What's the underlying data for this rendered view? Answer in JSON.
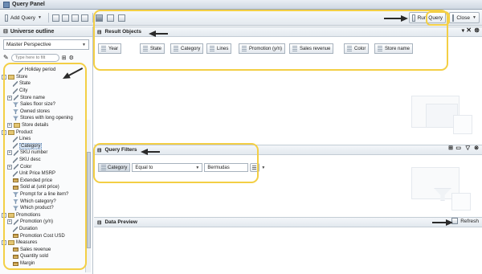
{
  "window": {
    "title": "Query Panel"
  },
  "toolbar": {
    "add_query_label": "Add Query",
    "run_query_label": "Run Query",
    "close_label": "Close"
  },
  "outline": {
    "title": "Universe outline",
    "perspective": "Master Perspective",
    "search_placeholder": "Type here to filt"
  },
  "tree": [
    {
      "label": "Holiday period",
      "indent": 3,
      "icon": "dimension",
      "expander": ""
    },
    {
      "label": "Store",
      "indent": 0,
      "icon": "folder",
      "expander": "-"
    },
    {
      "label": "State",
      "indent": 2,
      "icon": "dimension",
      "expander": ""
    },
    {
      "label": "City",
      "indent": 2,
      "icon": "dimension",
      "expander": ""
    },
    {
      "label": "Store name",
      "indent": 1,
      "icon": "dimension",
      "expander": "+"
    },
    {
      "label": "Sales floor size?",
      "indent": 2,
      "icon": "filter",
      "expander": ""
    },
    {
      "label": "Owned stores",
      "indent": 2,
      "icon": "filter",
      "expander": ""
    },
    {
      "label": "Stores with long opening",
      "indent": 2,
      "icon": "filter",
      "expander": ""
    },
    {
      "label": "Store details",
      "indent": 1,
      "icon": "folder",
      "expander": "+"
    },
    {
      "label": "Product",
      "indent": 0,
      "icon": "folder",
      "expander": "-"
    },
    {
      "label": "Lines",
      "indent": 2,
      "icon": "dimension",
      "expander": ""
    },
    {
      "label": "Category",
      "indent": 2,
      "icon": "dimension",
      "expander": "",
      "selected": true
    },
    {
      "label": "SKU number",
      "indent": 1,
      "icon": "dimension",
      "expander": "+"
    },
    {
      "label": "SKU desc",
      "indent": 2,
      "icon": "dimension",
      "expander": ""
    },
    {
      "label": "Color",
      "indent": 1,
      "icon": "dimension",
      "expander": "+"
    },
    {
      "label": "Unit Price MSRP",
      "indent": 2,
      "icon": "dimension",
      "expander": ""
    },
    {
      "label": "Extended price",
      "indent": 2,
      "icon": "measure",
      "expander": ""
    },
    {
      "label": "Sold at (unit price)",
      "indent": 2,
      "icon": "measure",
      "expander": ""
    },
    {
      "label": "Prompt for a line item?",
      "indent": 2,
      "icon": "filter",
      "expander": ""
    },
    {
      "label": "Which category?",
      "indent": 2,
      "icon": "filter",
      "expander": ""
    },
    {
      "label": "Which product?",
      "indent": 2,
      "icon": "filter",
      "expander": ""
    },
    {
      "label": "Promotions",
      "indent": 0,
      "icon": "folder",
      "expander": "-"
    },
    {
      "label": "Promotion (y/n)",
      "indent": 1,
      "icon": "dimension",
      "expander": "+"
    },
    {
      "label": "Duration",
      "indent": 2,
      "icon": "dimension",
      "expander": ""
    },
    {
      "label": "Promotion Cost USD",
      "indent": 2,
      "icon": "measure",
      "expander": ""
    },
    {
      "label": "Measures",
      "indent": 0,
      "icon": "folder",
      "expander": "-"
    },
    {
      "label": "Sales revenue",
      "indent": 2,
      "icon": "measure",
      "expander": ""
    },
    {
      "label": "Quantity sold",
      "indent": 2,
      "icon": "measure",
      "expander": ""
    },
    {
      "label": "Margin",
      "indent": 2,
      "icon": "measure",
      "expander": ""
    }
  ],
  "result_objects": {
    "title": "Result Objects",
    "items": [
      "Year",
      "State",
      "Category",
      "Lines",
      "Promotion (y/n)",
      "Sales revenue",
      "Color",
      "Store name"
    ]
  },
  "query_filters": {
    "title": "Query Filters",
    "object": "Category",
    "operator": "Equal to",
    "value": "Bermudas"
  },
  "data_preview": {
    "title": "Data Preview",
    "refresh_label": "Refresh"
  },
  "colors": {
    "highlight": "#f3cf45",
    "arrow": "#2a2a2a",
    "selection": "#d5e3f3"
  }
}
